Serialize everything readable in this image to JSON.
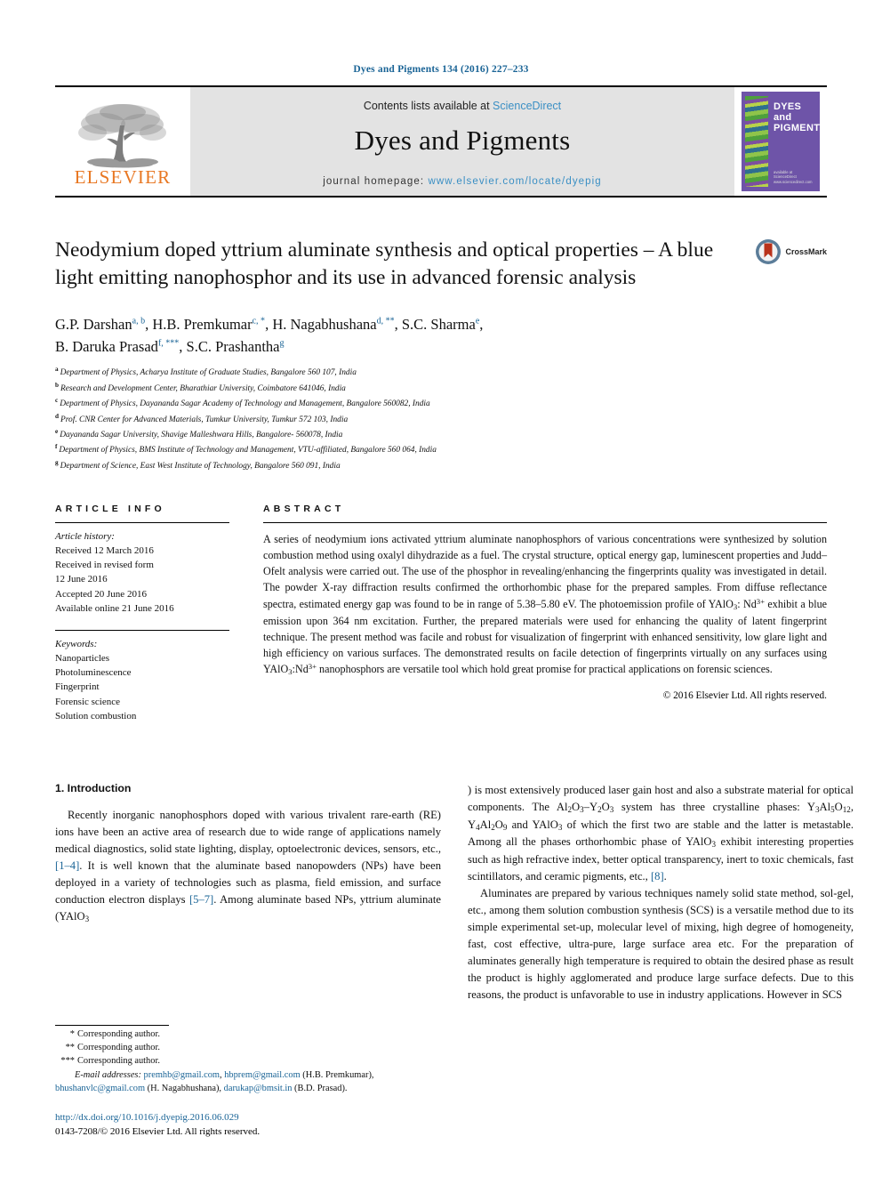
{
  "running_head": "Dyes and Pigments 134 (2016) 227–233",
  "masthead": {
    "publisher_name": "ELSEVIER",
    "contents_prefix": "Contents lists available at ",
    "contents_link": "ScienceDirect",
    "journal_name": "Dyes and Pigments",
    "homepage_prefix": "journal homepage: ",
    "homepage_url": "www.elsevier.com/locate/dyepig",
    "cover": {
      "title_line1": "DYES",
      "title_line2": "and",
      "title_line3": "PIGMENTS",
      "foot_line1": "available at",
      "foot_line2": "ScienceDirect",
      "foot_line3": "www.sciencedirect.com",
      "background_color": "#6e54a8"
    }
  },
  "title": "Neodymium doped yttrium aluminate synthesis and optical properties – A blue light emitting nanophosphor and its use in advanced forensic analysis",
  "crossmark": {
    "label": "CrossMark",
    "ring_color": "#5b7d99",
    "mark_color": "#b9321a"
  },
  "authors": {
    "line1": "G.P. Darshan",
    "line1_marks": "a, b",
    "author2": "H.B. Premkumar",
    "author2_marks": "c, *",
    "author3": "H. Nagabhushana",
    "author3_marks": "d, **",
    "author4": "S.C. Sharma",
    "author4_marks": "e",
    "author5": "B. Daruka Prasad",
    "author5_marks": "f, ***",
    "author6": "S.C. Prashantha",
    "author6_marks": "g"
  },
  "affiliations": [
    {
      "mark": "a",
      "text": "Department of Physics, Acharya Institute of Graduate Studies, Bangalore 560 107, India"
    },
    {
      "mark": "b",
      "text": "Research and Development Center, Bharathiar University, Coimbatore 641046, India"
    },
    {
      "mark": "c",
      "text": "Department of Physics, Dayananda Sagar Academy of Technology and Management, Bangalore 560082, India"
    },
    {
      "mark": "d",
      "text": "Prof. CNR Center for Advanced Materials, Tumkur University, Tumkur 572 103, India"
    },
    {
      "mark": "e",
      "text": "Dayananda Sagar University, Shavige Malleshwara Hills, Bangalore- 560078, India"
    },
    {
      "mark": "f",
      "text": "Department of Physics, BMS Institute of Technology and Management, VTU-affiliated, Bangalore 560 064, India"
    },
    {
      "mark": "g",
      "text": "Department of Science, East West Institute of Technology, Bangalore 560 091, India"
    }
  ],
  "article_info": {
    "heading": "ARTICLE INFO",
    "history_label": "Article history:",
    "history": [
      "Received 12 March 2016",
      "Received in revised form",
      "12 June 2016",
      "Accepted 20 June 2016",
      "Available online 21 June 2016"
    ],
    "keywords_label": "Keywords:",
    "keywords": [
      "Nanoparticles",
      "Photoluminescence",
      "Fingerprint",
      "Forensic science",
      "Solution combustion"
    ]
  },
  "abstract": {
    "heading": "ABSTRACT",
    "paragraph_part1": "A series of neodymium ions activated yttrium aluminate nanophosphors of various concentrations were synthesized by solution combustion method using oxalyl dihydrazide as a fuel. The crystal structure, optical energy gap, luminescent properties and Judd–Ofelt analysis were carried out. The use of the phosphor in revealing/enhancing the fingerprints quality was investigated in detail. The powder X-ray diffraction results confirmed the orthorhombic phase for the prepared samples. From diffuse reflectance spectra, estimated energy gap was found to be in range of 5.38–5.80 eV. The photoemission profile of YAlO",
    "sub1": "3",
    "paragraph_part2": ": Nd",
    "sup1": "3+",
    "paragraph_part3": " exhibit a blue emission upon 364 nm excitation. Further, the prepared materials were used for enhancing the quality of latent fingerprint technique. The present method was facile and robust for visualization of fingerprint with enhanced sensitivity, low glare light and high efficiency on various surfaces. The demonstrated results on facile detection of fingerprints virtually on any surfaces using YAlO",
    "sub2": "3",
    "paragraph_part4": ":Nd",
    "sup2": "3+",
    "paragraph_part5": " nanophosphors are versatile tool which hold great promise for practical applications on forensic sciences.",
    "copyright": "© 2016 Elsevier Ltd. All rights reserved."
  },
  "introduction": {
    "section_title": "1. Introduction",
    "p1_a": "Recently inorganic nanophosphors doped with various trivalent rare-earth (RE) ions have been an active area of research due to wide range of applications namely medical diagnostics, solid state lighting, display, optoelectronic devices, sensors, etc., ",
    "p1_ref1": "[1–4]",
    "p1_b": ". It is well known that the aluminate based nanopowders (NPs) have been deployed in a variety of technologies such as plasma, field emission, and surface conduction electron displays ",
    "p1_ref2": "[5–7]",
    "p1_c": ". Among aluminate based NPs, yttrium aluminate (YAlO",
    "p1_sub1": "3",
    "p1_d": ") is most extensively produced laser gain host and also a substrate material for optical components. The Al",
    "p1_sub2": "2",
    "p1_e": "O",
    "p1_sub3": "3",
    "p1_f": "–Y",
    "p1_sub4": "2",
    "p1_g": "O",
    "p1_sub5": "3",
    "p1_h": " system has three crystalline phases: Y",
    "p1_sub6": "3",
    "p1_i": "Al",
    "p1_sub7": "5",
    "p1_j": "O",
    "p1_sub8": "12",
    "p1_k": ", Y",
    "p1_sub9": "4",
    "p1_l": "Al",
    "p1_sub10": "2",
    "p1_m": "O",
    "p1_sub11": "9",
    "p1_n": " and YAlO",
    "p1_sub12": "3",
    "p1_o": " of which the first two are stable and the latter is metastable. Among all the phases orthorhombic phase of YAlO",
    "p1_sub13": "3",
    "p1_p": " exhibit interesting properties such as high refractive index, better optical transparency, inert to toxic chemicals, fast scintillators, and ceramic pigments, etc., ",
    "p1_ref3": "[8]",
    "p1_q": ".",
    "p2": "Aluminates are prepared by various techniques namely solid state method, sol-gel, etc., among them solution combustion synthesis (SCS) is a versatile method due to its simple experimental set-up, molecular level of mixing, high degree of homogeneity, fast, cost effective, ultra-pure, large surface area etc. For the preparation of aluminates generally high temperature is required to obtain the desired phase as result the product is highly agglomerated and produce large surface defects. Due to this reasons, the product is unfavorable to use in industry applications. However in SCS"
  },
  "footnotes": {
    "corr1": "Corresponding author.",
    "corr1_mark": "*",
    "corr2": "Corresponding author.",
    "corr2_mark": "**",
    "corr3": "Corresponding author.",
    "corr3_mark": "***",
    "emails_label": "E-mail addresses:",
    "email1": "premhb@gmail.com",
    "email1_sep": ", ",
    "email2": "hbprem@gmail.com",
    "email1_owner": " (H.B. Premkumar), ",
    "email3": "bhushanvlc@gmail.com",
    "email3_owner": " (H. Nagabhushana), ",
    "email4": "darukap@bmsit.in",
    "email4_owner": " (B.D. Prasad).",
    "doi": "http://dx.doi.org/10.1016/j.dyepig.2016.06.029",
    "issn_line": "0143-7208/© 2016 Elsevier Ltd. All rights reserved."
  }
}
